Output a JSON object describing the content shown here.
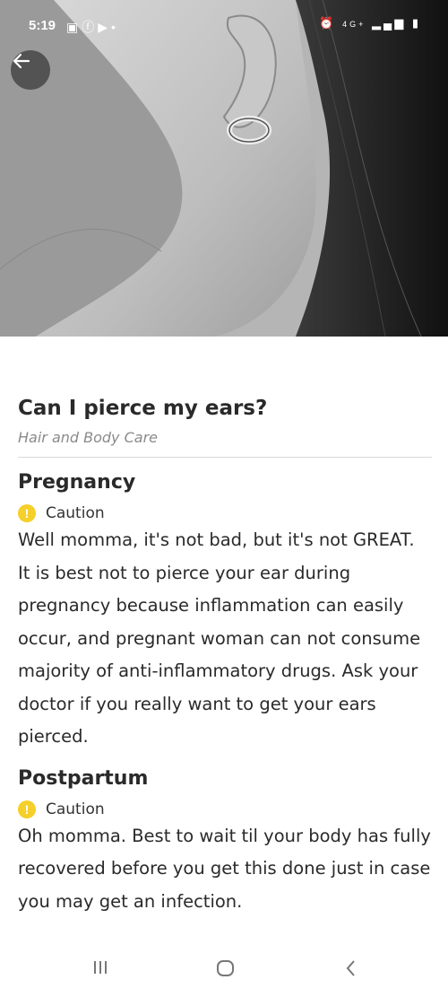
{
  "status_bar": {
    "time": "5:19",
    "left_icons": [
      "sim-icon",
      "facebook-icon",
      "youtube-icon",
      "dot-icon"
    ],
    "right_icons": [
      "alarm-icon",
      "network-4g-icon",
      "signal-icon",
      "battery-icon"
    ],
    "network_label": "4G+"
  },
  "hero": {
    "image": "ear-earring-photo"
  },
  "article": {
    "title": "Can I pierce my ears?",
    "category": "Hair and Body Care",
    "sections": [
      {
        "heading": "Pregnancy",
        "badge": {
          "icon": "caution-icon",
          "label": "Caution",
          "color": "#f5cf2a"
        },
        "body": "Well momma, it's not bad, but it's not GREAT. It is best not to pierce your ear during pregnancy because inflammation can easily occur, and pregnant woman can not consume majority of anti-inflammatory drugs. Ask your doctor if you really want to get your ears pierced."
      },
      {
        "heading": "Postpartum",
        "badge": {
          "icon": "caution-icon",
          "label": "Caution",
          "color": "#f5cf2a"
        },
        "body": "Oh momma. Best to wait til your body has fully recovered before you get this done just in case you may get an infection."
      }
    ]
  },
  "nav_bar": {
    "buttons": [
      "recent-apps-icon",
      "home-icon",
      "back-icon"
    ]
  }
}
